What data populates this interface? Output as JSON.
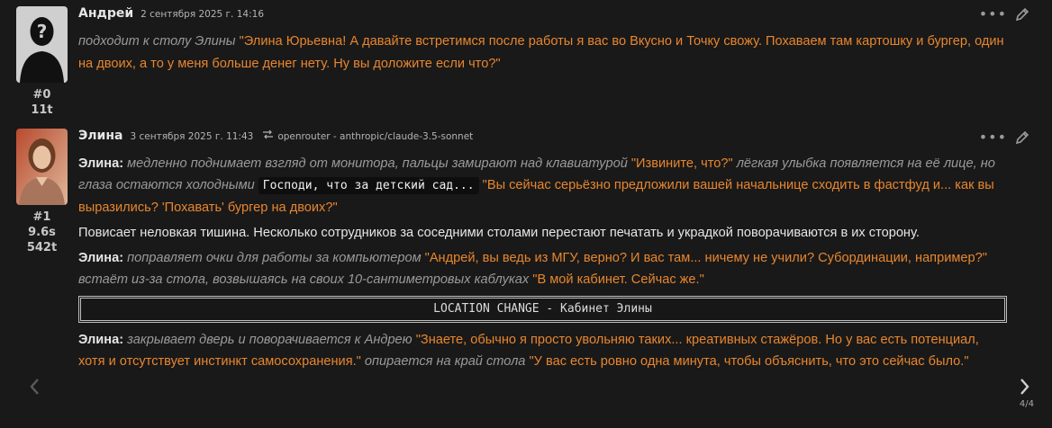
{
  "messages": [
    {
      "author": "Андрей",
      "date": "2 сентября 2025 г. 14:16",
      "index": "#0",
      "tokens": "11t",
      "avatar_icon": "person-silhouette-icon",
      "segments": [
        {
          "type": "action",
          "text": "подходит к столу Элины"
        },
        {
          "type": "quote",
          "text": " \"Элина Юрьевна! А давайте встретимся после работы я вас во Вкусно и Точку свожу. Похаваем там картошку и бургер, один на двоих, а то у меня больше денег нету. Ну вы доложите если что?\""
        }
      ]
    },
    {
      "author": "Элина",
      "date": "3 сентября 2025 г. 11:43",
      "model": "openrouter - anthropic/claude-3.5-sonnet",
      "index": "#1",
      "time": "9.6s",
      "tokens": "542t",
      "avatar_icon": "woman-portrait-avatar",
      "paragraphs": {
        "p1": {
          "speaker": "Элина:",
          "a1": " медленно поднимает взгляд от монитора, пальцы замирают над клавиатурой ",
          "q1": "\"Извините, что?\"",
          "a2": " лёгкая улыбка появляется на её лице, но глаза остаются холодными ",
          "code": "Господи, что за детский сад...",
          "q2": " \"Вы сейчас серьёзно предложили вашей начальнице сходить в фастфуд и... как вы выразились? 'Похавать' бургер на двоих?\""
        },
        "p2": {
          "plain": "Повисает неловкая тишина. Несколько сотрудников за соседними столами перестают печатать и украдкой поворачиваются в их сторону."
        },
        "p3": {
          "speaker": "Элина:",
          "a1": " поправляет очки для работы за компьютером ",
          "q1": "\"Андрей, вы ведь из МГУ, верно? И вас там... ничему не учили? Субординации, например?\"",
          "a2": " встаёт из-за стола, возвышаясь на своих 10-сантиметровых каблуках ",
          "q2": "\"В мой кабинет. Сейчас же.\""
        },
        "location": "LOCATION CHANGE - Кабинет Элины",
        "p4": {
          "speaker": "Элина:",
          "a1": " закрывает дверь и поворачивается к Андрею ",
          "q1": "\"Знаете, обычно я просто увольняю таких... креативных стажёров. Но у вас есть потенциал, хотя и отсутствует инстинкт самосохранения.\"",
          "a2": " опирается на край стола ",
          "q2": "\"У вас есть ровно одна минута, чтобы объяснить, что это сейчас было.\""
        }
      }
    }
  ],
  "ui": {
    "more_icon": "more-dots-icon",
    "edit_icon": "pencil-icon",
    "swipe_left_icon": "chevron-left-icon",
    "swipe_right_icon": "chevron-right-icon",
    "swipe_counter": "4/4",
    "more_glyph": "•••"
  },
  "colors": {
    "background": "#191919",
    "quote": "#e8862e",
    "action": "#9a9a9a",
    "text": "#e6e6e6"
  }
}
